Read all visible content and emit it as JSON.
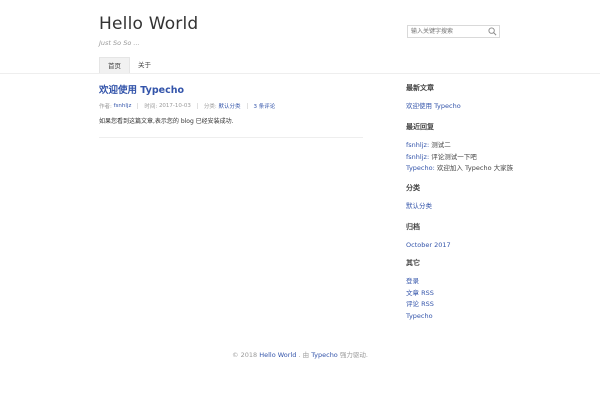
{
  "header": {
    "site_title": "Hello World",
    "site_desc": "Just So So ...",
    "search_placeholder": "输入关键字搜索"
  },
  "nav": {
    "home": "首页",
    "about": "关于"
  },
  "post": {
    "title": "欢迎使用 Typecho",
    "author_label": "作者:",
    "author": "fsnhljz",
    "date_label": "时间:",
    "date": "2017-10-03",
    "category_label": "分类:",
    "category": "默认分类",
    "comments": "3 条评论",
    "content": "如果您看到这篇文章,表示您的 blog 已经安装成功."
  },
  "sidebar": {
    "recent_posts": {
      "title": "最新文章",
      "items": [
        "欢迎使用 Typecho"
      ]
    },
    "recent_comments": {
      "title": "最近回复",
      "items": [
        {
          "author": "fsnhljz:",
          "text": "测试二"
        },
        {
          "author": "fsnhljz:",
          "text": "评论测试一下吧"
        },
        {
          "author": "Typecho:",
          "text": "欢迎加入 Typecho 大家族"
        }
      ]
    },
    "categories": {
      "title": "分类",
      "items": [
        "默认分类"
      ]
    },
    "archives": {
      "title": "归档",
      "items": [
        "October 2017"
      ]
    },
    "other": {
      "title": "其它",
      "items": [
        "登录",
        "文章 RSS",
        "评论 RSS",
        "Typecho"
      ]
    }
  },
  "footer": {
    "copyright": "© 2018",
    "site": "Hello World",
    "by": ". 由",
    "powered": "Typecho",
    "suffix": "强力驱动."
  },
  "colors": {
    "link": "#3354AA",
    "muted": "#999999",
    "text": "#444444"
  }
}
